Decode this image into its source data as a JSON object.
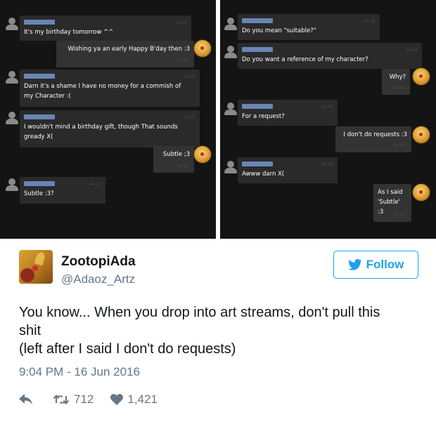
{
  "colors": {
    "chat_background": "#141414",
    "bubble": "#2a2a2a",
    "username_blur": "#6f8fc4",
    "twitter_blue": "#1da1f2",
    "secondary_text": "#657786"
  },
  "chat_left": {
    "messages": [
      {
        "direction": "in",
        "time": "16:24",
        "text": "It's my birthday tomorrow ^^"
      },
      {
        "direction": "out",
        "time": "16:25",
        "text": "Wishing ya an early Happy B'day then :3"
      },
      {
        "direction": "in",
        "time": "16:25",
        "text": "Darn it's a shame I have no money for a commish of\nmy Character :("
      },
      {
        "direction": "in",
        "time": "16:25",
        "text": "I wouldn't mind a birthday gift, though That sounds\ngready X("
      },
      {
        "direction": "out",
        "time": "16:26",
        "text": "Subtle ;3"
      },
      {
        "direction": "in",
        "time": "16:27",
        "text": "Subtle :3?"
      }
    ]
  },
  "chat_right": {
    "messages": [
      {
        "direction": "in",
        "time": "16:35",
        "text": "Do you mean \"suitable?\""
      },
      {
        "direction": "in",
        "time": "16:44",
        "text": "Do you want a reference of my character?"
      },
      {
        "direction": "out",
        "time": "16:44",
        "text": "Why?"
      },
      {
        "direction": "in",
        "time": "16:45",
        "text": "For a request?"
      },
      {
        "direction": "out",
        "time": "16:45",
        "text": "I don't do requests :3"
      },
      {
        "direction": "in",
        "time": "16:46",
        "text": "Awww darn X("
      },
      {
        "direction": "out",
        "time": "16:47",
        "text": "As I said\n'Subtle' :3"
      }
    ]
  },
  "tweet": {
    "display_name": "ZootopiAda",
    "handle": "@Adaoz_Artz",
    "follow_label": "Follow",
    "text_line1": "You know... When you drop into art streams, don't pull this",
    "text_line2": "shit",
    "text_line3": "(left after I said I don't do requests)",
    "timestamp": "9:04 PM - 16 Jun 2016",
    "retweets": "712",
    "likes": "1,421",
    "icons": [
      "reply-icon",
      "retweet-icon",
      "heart-icon",
      "twitter-bird-icon"
    ]
  }
}
